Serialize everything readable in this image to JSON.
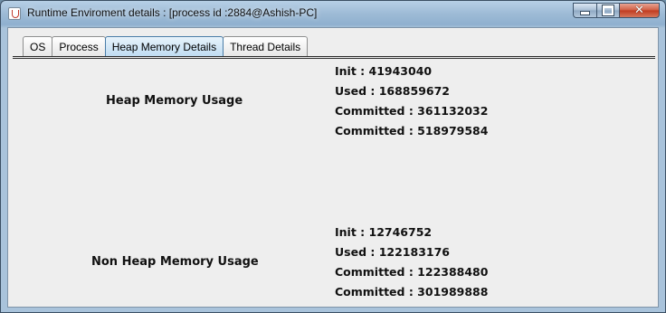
{
  "window": {
    "title": "Runtime Enviroment details : [process id :2884@Ashish-PC]",
    "close_glyph": "✕"
  },
  "tabs": [
    {
      "label": "OS"
    },
    {
      "label": "Process"
    },
    {
      "label": "Heap Memory Details",
      "selected": true
    },
    {
      "label": "Thread Details"
    }
  ],
  "heap": {
    "label": "Heap Memory Usage",
    "init": "Init : 41943040",
    "used": "Used : 168859672",
    "committed": "Committed : 361132032",
    "max": "Committed : 518979584"
  },
  "non_heap": {
    "label": "Non Heap Memory Usage",
    "init": "Init : 12746752",
    "used": "Used : 122183176",
    "committed": "Committed : 122388480",
    "max": "Committed : 301989888"
  },
  "colors": {
    "selected_tab": "#bfdcf2",
    "panel_background": "#eeeeee"
  }
}
